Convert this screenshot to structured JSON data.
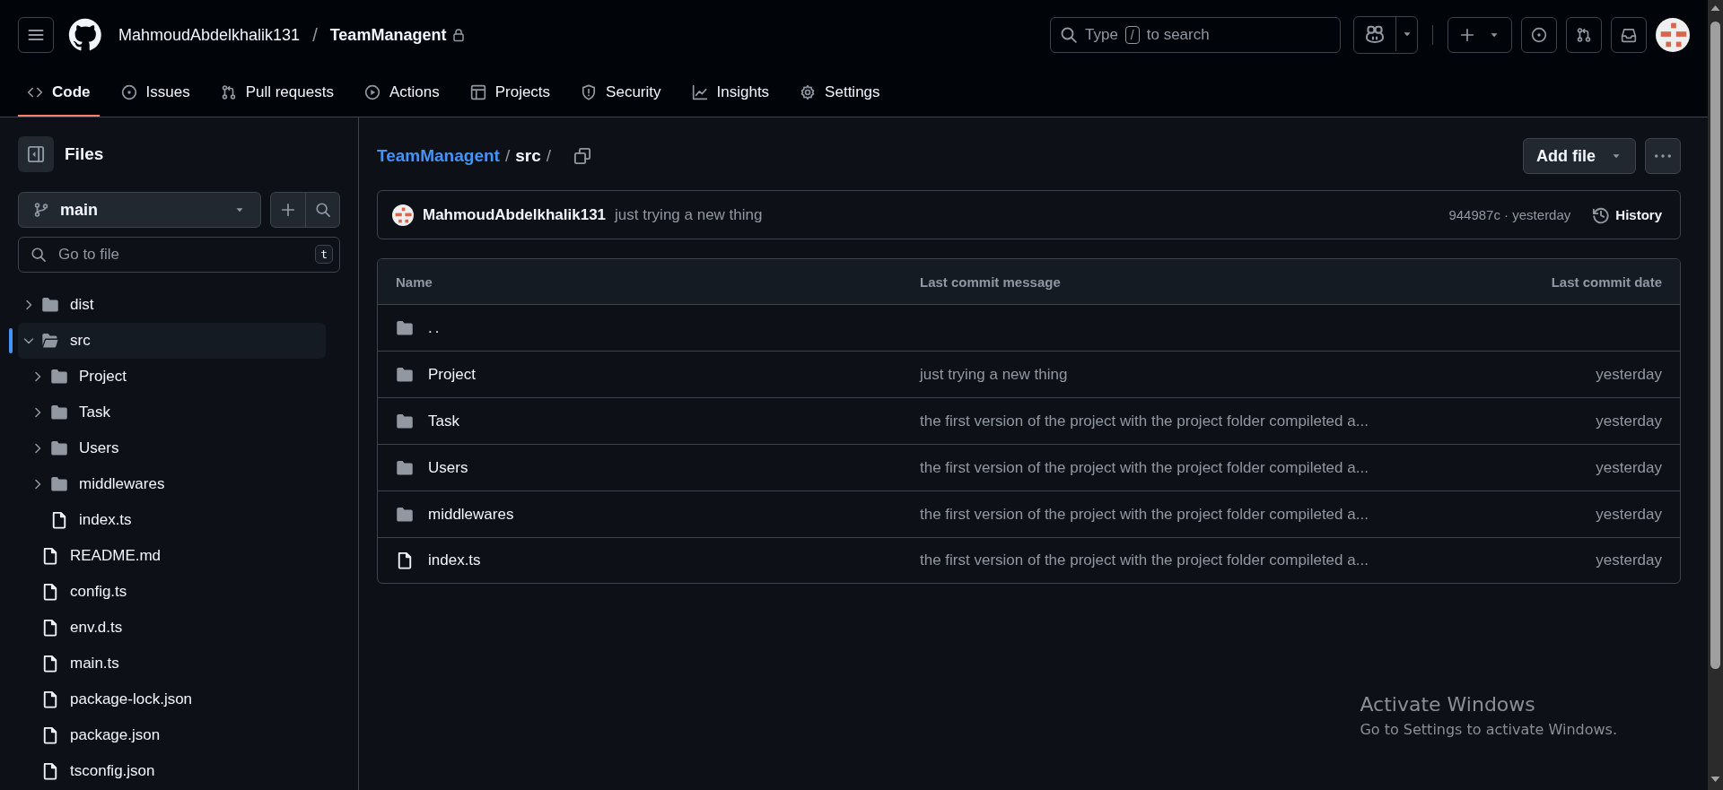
{
  "header": {
    "owner": "MahmoudAbdelkhalik131",
    "separator": "/",
    "repo": "TeamManagent",
    "private": true,
    "search": {
      "prefix": "Type",
      "key": "/",
      "suffix": "to search"
    }
  },
  "nav_tabs": [
    {
      "label": "Code",
      "selected": true
    },
    {
      "label": "Issues",
      "selected": false
    },
    {
      "label": "Pull requests",
      "selected": false
    },
    {
      "label": "Actions",
      "selected": false
    },
    {
      "label": "Projects",
      "selected": false
    },
    {
      "label": "Security",
      "selected": false
    },
    {
      "label": "Insights",
      "selected": false
    },
    {
      "label": "Settings",
      "selected": false
    }
  ],
  "sidebar": {
    "title": "Files",
    "branch": "main",
    "filter": {
      "placeholder": "Go to file",
      "shortcut": "t"
    },
    "tree": [
      {
        "name": "dist",
        "kind": "folder",
        "expanded": false,
        "selected": false
      },
      {
        "name": "src",
        "kind": "folder",
        "expanded": true,
        "selected": true,
        "children": [
          {
            "name": "Project",
            "kind": "folder",
            "expanded": false,
            "selected": false
          },
          {
            "name": "Task",
            "kind": "folder",
            "expanded": false,
            "selected": false
          },
          {
            "name": "Users",
            "kind": "folder",
            "expanded": false,
            "selected": false
          },
          {
            "name": "middlewares",
            "kind": "folder",
            "expanded": false,
            "selected": false
          },
          {
            "name": "index.ts",
            "kind": "file",
            "selected": false
          }
        ]
      },
      {
        "name": "README.md",
        "kind": "file",
        "selected": false
      },
      {
        "name": "config.ts",
        "kind": "file",
        "selected": false
      },
      {
        "name": "env.d.ts",
        "kind": "file",
        "selected": false
      },
      {
        "name": "main.ts",
        "kind": "file",
        "selected": false
      },
      {
        "name": "package-lock.json",
        "kind": "file",
        "selected": false
      },
      {
        "name": "package.json",
        "kind": "file",
        "selected": false
      },
      {
        "name": "tsconfig.json",
        "kind": "file",
        "selected": false
      }
    ]
  },
  "breadcrumb": [
    {
      "kind": "link",
      "text": "TeamManagent"
    },
    {
      "kind": "separator",
      "text": "/"
    },
    {
      "kind": "current",
      "text": "src"
    },
    {
      "kind": "separator",
      "text": "/"
    }
  ],
  "add_file_button": "Add file",
  "latest_commit": {
    "author": "MahmoudAbdelkhalik131",
    "message": "just trying a new thing",
    "sha_time": "944987c · yesterday",
    "history": "History"
  },
  "table": {
    "columns": [
      "Name",
      "Last commit message",
      "Last commit date"
    ],
    "rows": [
      {
        "kind": "parent",
        "name": ".."
      },
      {
        "kind": "folder",
        "name": "Project",
        "message": "just trying a new thing",
        "date": "yesterday"
      },
      {
        "kind": "folder",
        "name": "Task",
        "message": "the first version of the project with the project folder compileted a...",
        "date": "yesterday"
      },
      {
        "kind": "folder",
        "name": "Users",
        "message": "the first version of the project with the project folder compileted a...",
        "date": "yesterday"
      },
      {
        "kind": "folder",
        "name": "middlewares",
        "message": "the first version of the project with the project folder compileted a...",
        "date": "yesterday"
      },
      {
        "kind": "file",
        "name": "index.ts",
        "message": "the first version of the project with the project folder compileted a...",
        "date": "yesterday"
      }
    ]
  },
  "os_overlay": {
    "title": "Activate Windows",
    "subtitle": "Go to Settings to activate Windows."
  }
}
